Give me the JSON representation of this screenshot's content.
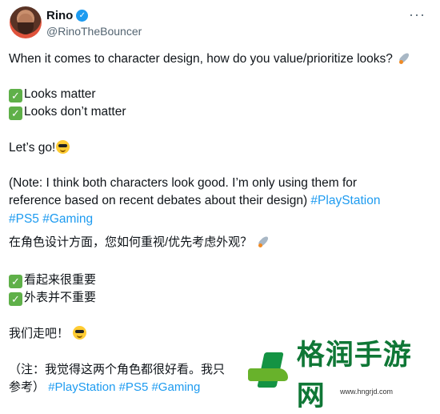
{
  "profile": {
    "name": "Rino",
    "handle": "@RinoTheBouncer"
  },
  "tweet": {
    "line1": "When it comes to character design, how do you value/prioritize looks?",
    "line2": "Looks matter",
    "line3": "Looks don’t matter",
    "line4": "Let’s go!",
    "line5": "(Note: I think both characters look good. I’m only using them for",
    "line6_text": "reference based on recent debates about their design) ",
    "line6_hashtag": "#PlayStation",
    "line7_hashtag1": "#PS5",
    "line7_hashtag2": "#Gaming",
    "zh1": "在角色设计方面，您如何重视/优先考虑外观？",
    "zh2": "看起来很重要",
    "zh3": "外表并不重要",
    "zh4": "我们走吧！",
    "zh5": "（注：我觉得这两个角色都很好看。我只",
    "zh6_prefix": "参考）",
    "zh6_hashtag1": "#PlayStation",
    "zh6_hashtag2": "#PS5",
    "zh6_hashtag3": "#Gaming"
  },
  "watermark": {
    "text": "格润手游网",
    "url": "www.hngrjd.com"
  },
  "colors": {
    "hashtag": "#1d9bf0",
    "verified": "#1d9bf0",
    "check": "#5fb049",
    "watermark": "#0f7736"
  },
  "icons": {
    "verified": "verified-badge-icon",
    "more": "more-options-icon",
    "check": "check-mark-icon",
    "rocket": "rocket-emoji-icon",
    "cool": "sunglasses-emoji-icon"
  }
}
